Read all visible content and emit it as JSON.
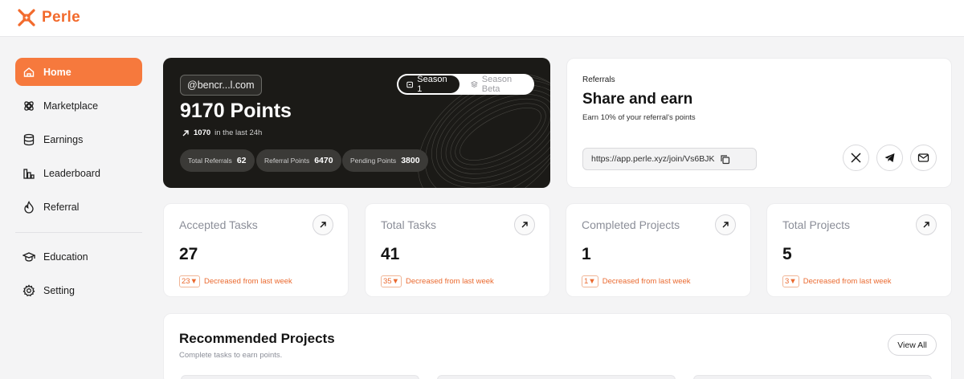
{
  "app": {
    "name": "Perle",
    "brand_color": "#f26a2c"
  },
  "sidebar": {
    "items": [
      {
        "label": "Home",
        "icon": "home-icon",
        "active": true
      },
      {
        "label": "Marketplace",
        "icon": "marketplace-icon",
        "active": false
      },
      {
        "label": "Earnings",
        "icon": "database-icon",
        "active": false
      },
      {
        "label": "Leaderboard",
        "icon": "leaderboard-icon",
        "active": false
      },
      {
        "label": "Referral",
        "icon": "flame-icon",
        "active": false
      },
      {
        "label": "Education",
        "icon": "graduation-cap-icon",
        "active": false
      },
      {
        "label": "Setting",
        "icon": "gear-icon",
        "active": false
      }
    ]
  },
  "hero": {
    "email": "@bencr...l.com",
    "seasons": [
      "Season 1",
      "Season Beta"
    ],
    "active_season": "Season 1",
    "points": "9170 Points",
    "delta_value": "1070",
    "delta_text": "in the last 24h",
    "stats": [
      {
        "label": "Total Referrals",
        "value": "62"
      },
      {
        "label": "Referral Points",
        "value": "6470"
      },
      {
        "label": "Pending Points",
        "value": "3800"
      }
    ]
  },
  "referrals": {
    "kicker": "Referrals",
    "title": "Share and earn",
    "subtitle": "Earn 10% of your referral's points",
    "link": "https://app.perle.xyz/join/Vs6BJK",
    "share_icons": [
      "x-icon",
      "telegram-icon",
      "mail-icon"
    ]
  },
  "stats": [
    {
      "label": "Accepted Tasks",
      "value": "27",
      "change": "23",
      "change_text": "Decreased from last week"
    },
    {
      "label": "Total Tasks",
      "value": "41",
      "change": "35",
      "change_text": "Decreased from last week"
    },
    {
      "label": "Completed Projects",
      "value": "1",
      "change": "1",
      "change_text": "Decreased from last week"
    },
    {
      "label": "Total Projects",
      "value": "5",
      "change": "3",
      "change_text": "Decreased from last week"
    }
  ],
  "recommended": {
    "title": "Recommended Projects",
    "subtitle": "Complete tasks to earn points.",
    "view_all": "View All"
  },
  "colors": {
    "accent": "#f6793d",
    "hero_bg": "#1b1a17",
    "decrease": "#ea6a30"
  }
}
